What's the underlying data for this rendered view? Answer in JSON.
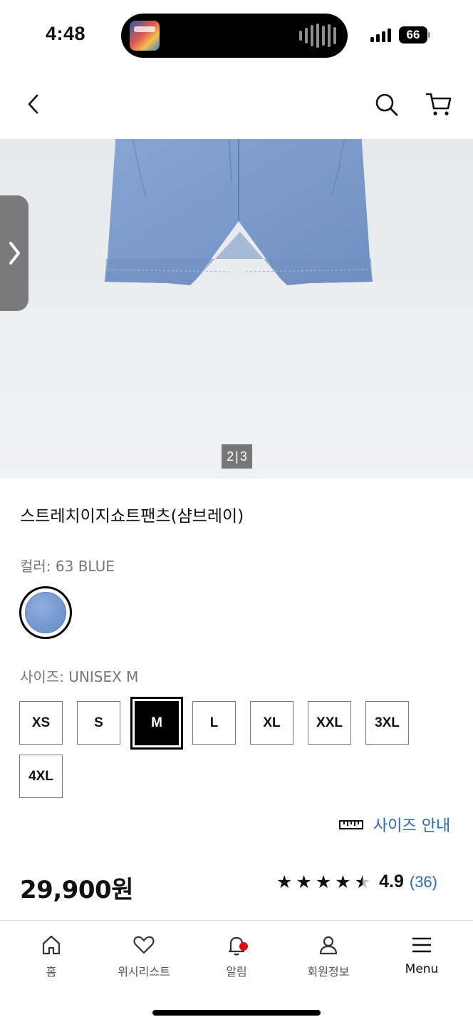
{
  "status_bar": {
    "time": "4:48",
    "battery": "66"
  },
  "header": {
    "back_label": "back",
    "search_label": "search",
    "cart_label": "cart"
  },
  "gallery": {
    "current": "2",
    "total": "3"
  },
  "product": {
    "name": "스트레치이지쇼트팬츠(샴브레이)",
    "color_label": "컬러: 63 BLUE",
    "swatch_color": "#7397cf",
    "size_label": "사이즈: UNISEX M",
    "sizes": [
      "XS",
      "S",
      "M",
      "L",
      "XL",
      "XXL",
      "3XL",
      "4XL"
    ],
    "selected_size": "M",
    "size_guide": "사이즈 안내",
    "price": "29,900원",
    "rating": {
      "stars": 4.5,
      "value": "4.9",
      "count": "(36)"
    }
  },
  "bottom_nav": {
    "home": "홈",
    "wishlist": "위시리스트",
    "alerts": "알림",
    "member": "회원정보",
    "menu": "Menu"
  }
}
